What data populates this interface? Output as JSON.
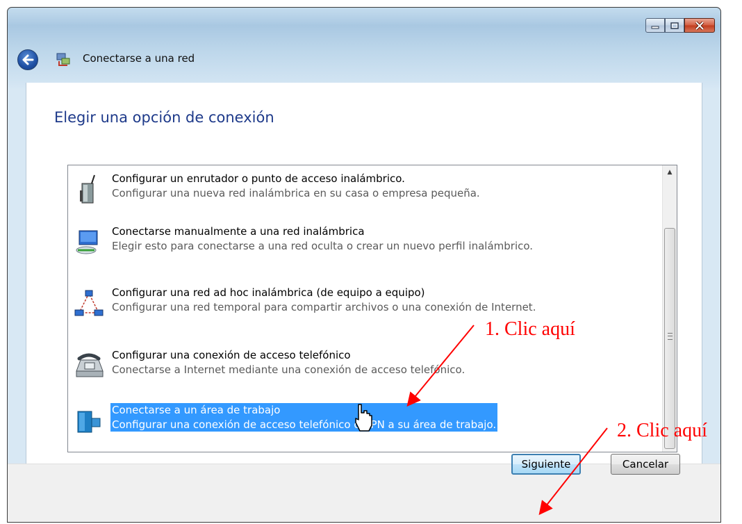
{
  "window": {
    "title": "Conectarse a una red"
  },
  "heading": "Elegir una opción de conexión",
  "options": [
    {
      "title": "Configurar un enrutador o punto de acceso inalámbrico.",
      "description": "Configurar una nueva red inalámbrica en su casa o empresa pequeña.",
      "icon": "router-icon",
      "selected": false
    },
    {
      "title": "Conectarse manualmente a una red inalámbrica",
      "description": "Elegir esto para conectarse a una red oculta o crear un nuevo perfil inalámbrico.",
      "icon": "wireless-network-icon",
      "selected": false
    },
    {
      "title": "Configurar una red ad hoc inalámbrica (de equipo a equipo)",
      "description": "Configurar una red temporal para compartir archivos o una conexión de Internet.",
      "icon": "ad-hoc-network-icon",
      "selected": false
    },
    {
      "title": "Configurar una conexión de acceso telefónico",
      "description": "Conectarse a Internet mediante una conexión de acceso telefónico.",
      "icon": "telephone-icon",
      "selected": false
    },
    {
      "title": "Conectarse a un área de trabajo",
      "description": "Configurar una conexión de acceso telefónico o VPN a su área de trabajo.",
      "icon": "workplace-icon",
      "selected": true
    }
  ],
  "buttons": {
    "next": "Siguiente",
    "cancel": "Cancelar"
  },
  "annotations": {
    "step1": "1. Clic aquí",
    "step2": "2. Clic aquí"
  },
  "colors": {
    "selection": "#3399ff",
    "heading": "#1e3a8a",
    "annotation": "#ff0000"
  }
}
